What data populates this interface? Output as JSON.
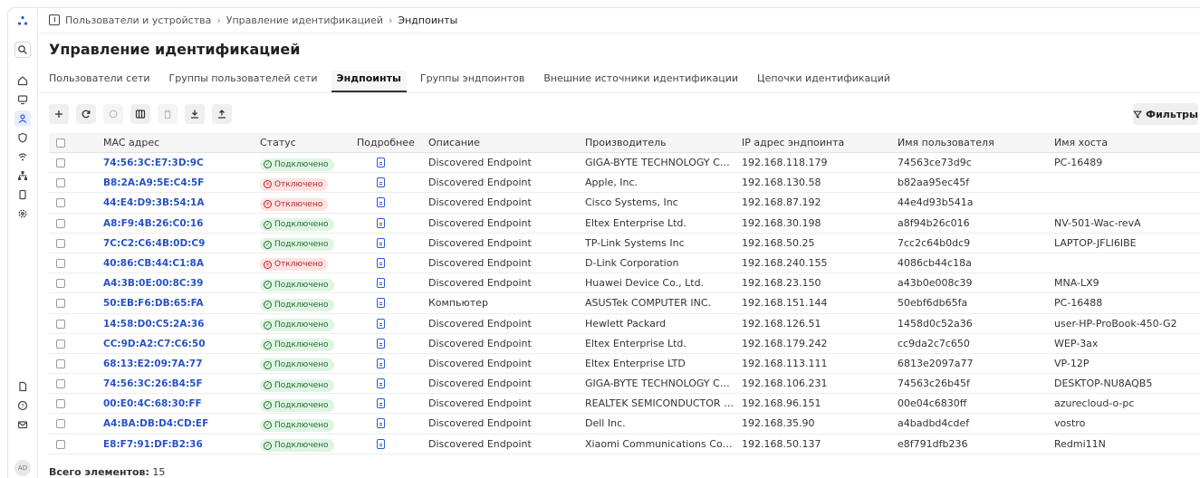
{
  "breadcrumb": {
    "items": [
      "Пользователи и устройства",
      "Управление идентификацией",
      "Эндпоинты"
    ]
  },
  "page": {
    "title": "Управление идентификацией"
  },
  "tabs": [
    {
      "label": "Пользователи сети",
      "active": false
    },
    {
      "label": "Группы пользователей сети",
      "active": false
    },
    {
      "label": "Эндпоинты",
      "active": true
    },
    {
      "label": "Группы эндпоинтов",
      "active": false
    },
    {
      "label": "Внешние источники идентификации",
      "active": false
    },
    {
      "label": "Цепочки идентификаций",
      "active": false
    }
  ],
  "toolbar": {
    "filters_label": "Фильтры"
  },
  "table": {
    "headers": {
      "mac": "MAC адрес",
      "status": "Статус",
      "details": "Подробнее",
      "description": "Описание",
      "vendor": "Производитель",
      "ip": "IP адрес эндпоинта",
      "user": "Имя пользователя",
      "host": "Имя хоста"
    },
    "status_labels": {
      "ok": "Подключено",
      "off": "Отключено"
    },
    "rows": [
      {
        "mac": "74:56:3C:E7:3D:9C",
        "status": "ok",
        "description": "Discovered Endpoint",
        "vendor": "GIGA-BYTE TECHNOLOGY CO.,L...",
        "ip": "192.168.118.179",
        "user": "74563ce73d9c",
        "host": "PC-16489"
      },
      {
        "mac": "B8:2A:A9:5E:C4:5F",
        "status": "off",
        "description": "Discovered Endpoint",
        "vendor": "Apple, Inc.",
        "ip": "192.168.130.58",
        "user": "b82aa95ec45f",
        "host": ""
      },
      {
        "mac": "44:E4:D9:3B:54:1A",
        "status": "off",
        "description": "Discovered Endpoint",
        "vendor": "Cisco Systems, Inc",
        "ip": "192.168.87.192",
        "user": "44e4d93b541a",
        "host": ""
      },
      {
        "mac": "A8:F9:4B:26:C0:16",
        "status": "ok",
        "description": "Discovered Endpoint",
        "vendor": "Eltex Enterprise Ltd.",
        "ip": "192.168.30.198",
        "user": "a8f94b26c016",
        "host": "NV-501-Wac-revA"
      },
      {
        "mac": "7C:C2:C6:4B:0D:C9",
        "status": "ok",
        "description": "Discovered Endpoint",
        "vendor": "TP-Link Systems Inc",
        "ip": "192.168.50.25",
        "user": "7cc2c64b0dc9",
        "host": "LAPTOP-JFLI6IBE"
      },
      {
        "mac": "40:86:CB:44:C1:8A",
        "status": "off",
        "description": "Discovered Endpoint",
        "vendor": "D-Link Corporation",
        "ip": "192.168.240.155",
        "user": "4086cb44c18a",
        "host": ""
      },
      {
        "mac": "A4:3B:0E:00:8C:39",
        "status": "ok",
        "description": "Discovered Endpoint",
        "vendor": "Huawei Device Co., Ltd.",
        "ip": "192.168.23.150",
        "user": "a43b0e008c39",
        "host": "MNA-LX9"
      },
      {
        "mac": "50:EB:F6:DB:65:FA",
        "status": "ok",
        "description": "Компьютер",
        "vendor": "ASUSTek COMPUTER INC.",
        "ip": "192.168.151.144",
        "user": "50ebf6db65fa",
        "host": "PC-16488"
      },
      {
        "mac": "14:58:D0:C5:2A:36",
        "status": "ok",
        "description": "Discovered Endpoint",
        "vendor": "Hewlett Packard",
        "ip": "192.168.126.51",
        "user": "1458d0c52a36",
        "host": "user-HP-ProBook-450-G2"
      },
      {
        "mac": "CC:9D:A2:C7:C6:50",
        "status": "ok",
        "description": "Discovered Endpoint",
        "vendor": "Eltex Enterprise Ltd.",
        "ip": "192.168.179.242",
        "user": "cc9da2c7c650",
        "host": "WEP-3ax"
      },
      {
        "mac": "68:13:E2:09:7A:77",
        "status": "ok",
        "description": "Discovered Endpoint",
        "vendor": "Eltex Enterprise LTD",
        "ip": "192.168.113.111",
        "user": "6813e2097a77",
        "host": "VP-12P"
      },
      {
        "mac": "74:56:3C:26:B4:5F",
        "status": "ok",
        "description": "Discovered Endpoint",
        "vendor": "GIGA-BYTE TECHNOLOGY CO.,L...",
        "ip": "192.168.106.231",
        "user": "74563c26b45f",
        "host": "DESKTOP-NU8AQB5"
      },
      {
        "mac": "00:E0:4C:68:30:FF",
        "status": "ok",
        "description": "Discovered Endpoint",
        "vendor": "REALTEK SEMICONDUCTOR CO...",
        "ip": "192.168.96.151",
        "user": "00e04c6830ff",
        "host": "azurecloud-o-pc"
      },
      {
        "mac": "A4:BA:DB:D4:CD:EF",
        "status": "ok",
        "description": "Discovered Endpoint",
        "vendor": "Dell Inc.",
        "ip": "192.168.35.90",
        "user": "a4badbd4cdef",
        "host": "vostro"
      },
      {
        "mac": "E8:F7:91:DF:B2:36",
        "status": "ok",
        "description": "Discovered Endpoint",
        "vendor": "Xiaomi Communications Co Ltd",
        "ip": "192.168.50.137",
        "user": "e8f791dfb236",
        "host": "Redmi11N"
      }
    ]
  },
  "footer": {
    "total_label": "Всего элементов:",
    "total_value": "15"
  },
  "user": {
    "initials": "AD"
  },
  "colors": {
    "accent": "#2752c4",
    "ok_bg": "#dff5e3",
    "off_bg": "#fde2e2"
  },
  "icons": {
    "sidebar": [
      "logo-icon",
      "search-icon",
      "home-icon",
      "monitor-icon",
      "users-icon",
      "shield-icon",
      "wifi-icon",
      "network-icon",
      "device-icon",
      "settings-icon",
      "document-icon",
      "help-icon",
      "mail-icon"
    ],
    "toolbar": [
      "add-icon",
      "refresh-icon",
      "comment-icon",
      "columns-icon",
      "trash-icon",
      "download-icon",
      "upload-icon"
    ]
  }
}
